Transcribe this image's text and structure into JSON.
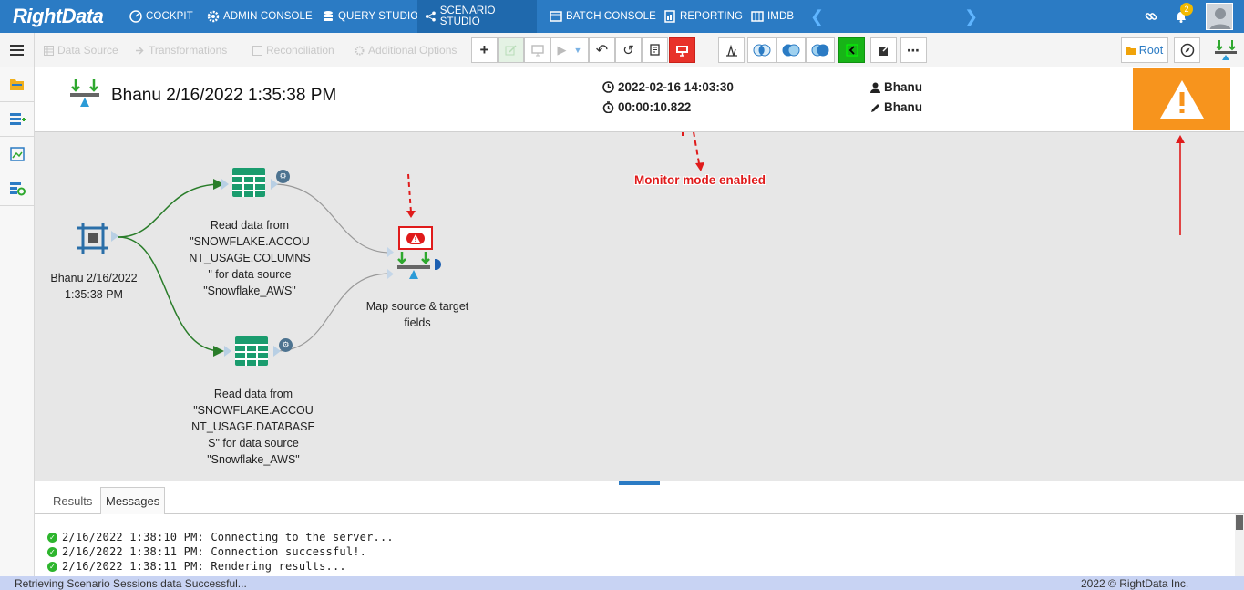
{
  "brand": {
    "logo_text": "RightData"
  },
  "nav": {
    "items": [
      {
        "label": "COCKPIT",
        "icon": "cockpit-icon"
      },
      {
        "label": "ADMIN CONSOLE",
        "icon": "gear-icon"
      },
      {
        "label": "QUERY STUDIO",
        "icon": "database-icon"
      },
      {
        "label": "SCENARIO STUDIO",
        "icon": "scenario-icon",
        "active": true
      },
      {
        "label": "BATCH CONSOLE",
        "icon": "batch-icon"
      },
      {
        "label": "REPORTING",
        "icon": "report-icon"
      },
      {
        "label": "IMDB",
        "icon": "imdb-icon"
      }
    ],
    "notification_count": "2"
  },
  "toolbar": {
    "menu_tabs": [
      "Data Source",
      "Transformations",
      "Reconciliation",
      "Additional Options"
    ],
    "root_label": "Root"
  },
  "header": {
    "title": "Bhanu 2/16/2022 1:35:38 PM",
    "timestamp": "2022-02-16 14:03:30",
    "duration": "00:00:10.822",
    "created_by": "Bhanu",
    "modified_by": "Bhanu"
  },
  "canvas": {
    "nodes": {
      "start": "Bhanu 2/16/2022 1:35:38 PM",
      "source1": "Read data from \"SNOWFLAKE.ACCOUNT_USAGE.COLUMNS\" for data source \"Snowflake_AWS\"",
      "source2": "Read data from \"SNOWFLAKE.ACCOUNT_USAGE.DATABASES\" for data source \"Snowflake_AWS\"",
      "map": "Map source & target fields"
    },
    "start_lines": [
      "Bhanu 2/16/2022",
      "1:35:38 PM"
    ],
    "source1_lines": [
      "Read data from",
      "\"SNOWFLAKE.ACCOU",
      "NT_USAGE.COLUMNS",
      "\" for data source",
      "\"Snowflake_AWS\""
    ],
    "source2_lines": [
      "Read data from",
      "\"SNOWFLAKE.ACCOU",
      "NT_USAGE.DATABASE",
      "S\" for data source",
      "\"Snowflake_AWS\""
    ],
    "map_lines": [
      "Map source & target",
      "fields"
    ],
    "callout": "Monitor mode enabled"
  },
  "bottom": {
    "tabs": [
      "Results",
      "Messages"
    ],
    "active_tab": "Messages",
    "messages": [
      "2/16/2022 1:38:10 PM: Connecting to the server...",
      "2/16/2022 1:38:11 PM: Connection successful!.",
      "2/16/2022 1:38:11 PM: Rendering results..."
    ]
  },
  "status": {
    "left": "Retrieving Scenario Sessions data Successful...",
    "right": "2022 © RightData Inc."
  },
  "colors": {
    "nav_bg": "#2b7bc4",
    "warning_orange": "#f7941d",
    "alert_red": "#e8322a",
    "grid_green": "#1a9c6e"
  }
}
